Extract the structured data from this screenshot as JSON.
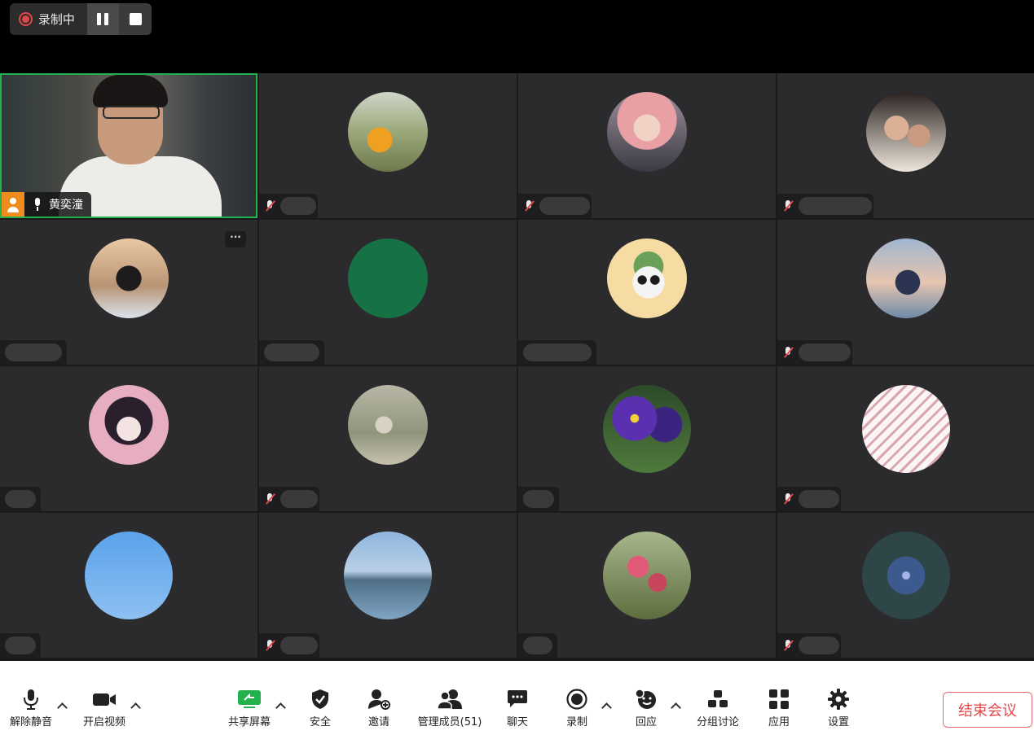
{
  "recording": {
    "status_label": "录制中"
  },
  "self": {
    "name": "黄奕潼"
  },
  "tiles": [
    {
      "avatar": "avatar-photo-orange-jacket",
      "muted": true
    },
    {
      "avatar": "avatar-anime-pink-hair",
      "muted": true
    },
    {
      "avatar": "avatar-couple-selfie",
      "muted": true
    },
    {
      "avatar": "avatar-girl-cafe",
      "muted": false
    },
    {
      "avatar": "avatar-green-circle",
      "muted": false
    },
    {
      "avatar": "avatar-cartoon-panda",
      "muted": false
    },
    {
      "avatar": "avatar-girl-sunset",
      "muted": true
    },
    {
      "avatar": "avatar-anime-horns",
      "muted": false
    },
    {
      "avatar": "avatar-person-bridge",
      "muted": true
    },
    {
      "avatar": "avatar-purple-pansy",
      "muted": false
    },
    {
      "avatar": "avatar-striped-pattern",
      "muted": true
    },
    {
      "avatar": "avatar-blue-sky",
      "muted": false
    },
    {
      "avatar": "avatar-city-waterfront",
      "muted": true
    },
    {
      "avatar": "avatar-pink-blossom",
      "muted": false
    },
    {
      "avatar": "avatar-fireworks",
      "muted": true
    }
  ],
  "toolbar": {
    "unmute": "解除静音",
    "video": "开启视频",
    "share": "共享屏幕",
    "security": "安全",
    "invite": "邀请",
    "participants": "管理成员(51)",
    "chat": "聊天",
    "record": "录制",
    "reactions": "回应",
    "breakout": "分组讨论",
    "apps": "应用",
    "settings": "设置",
    "end": "结束会议"
  },
  "colors": {
    "accent_green": "#22b14c",
    "host_orange": "#f08c1e",
    "end_red": "#e04848"
  }
}
